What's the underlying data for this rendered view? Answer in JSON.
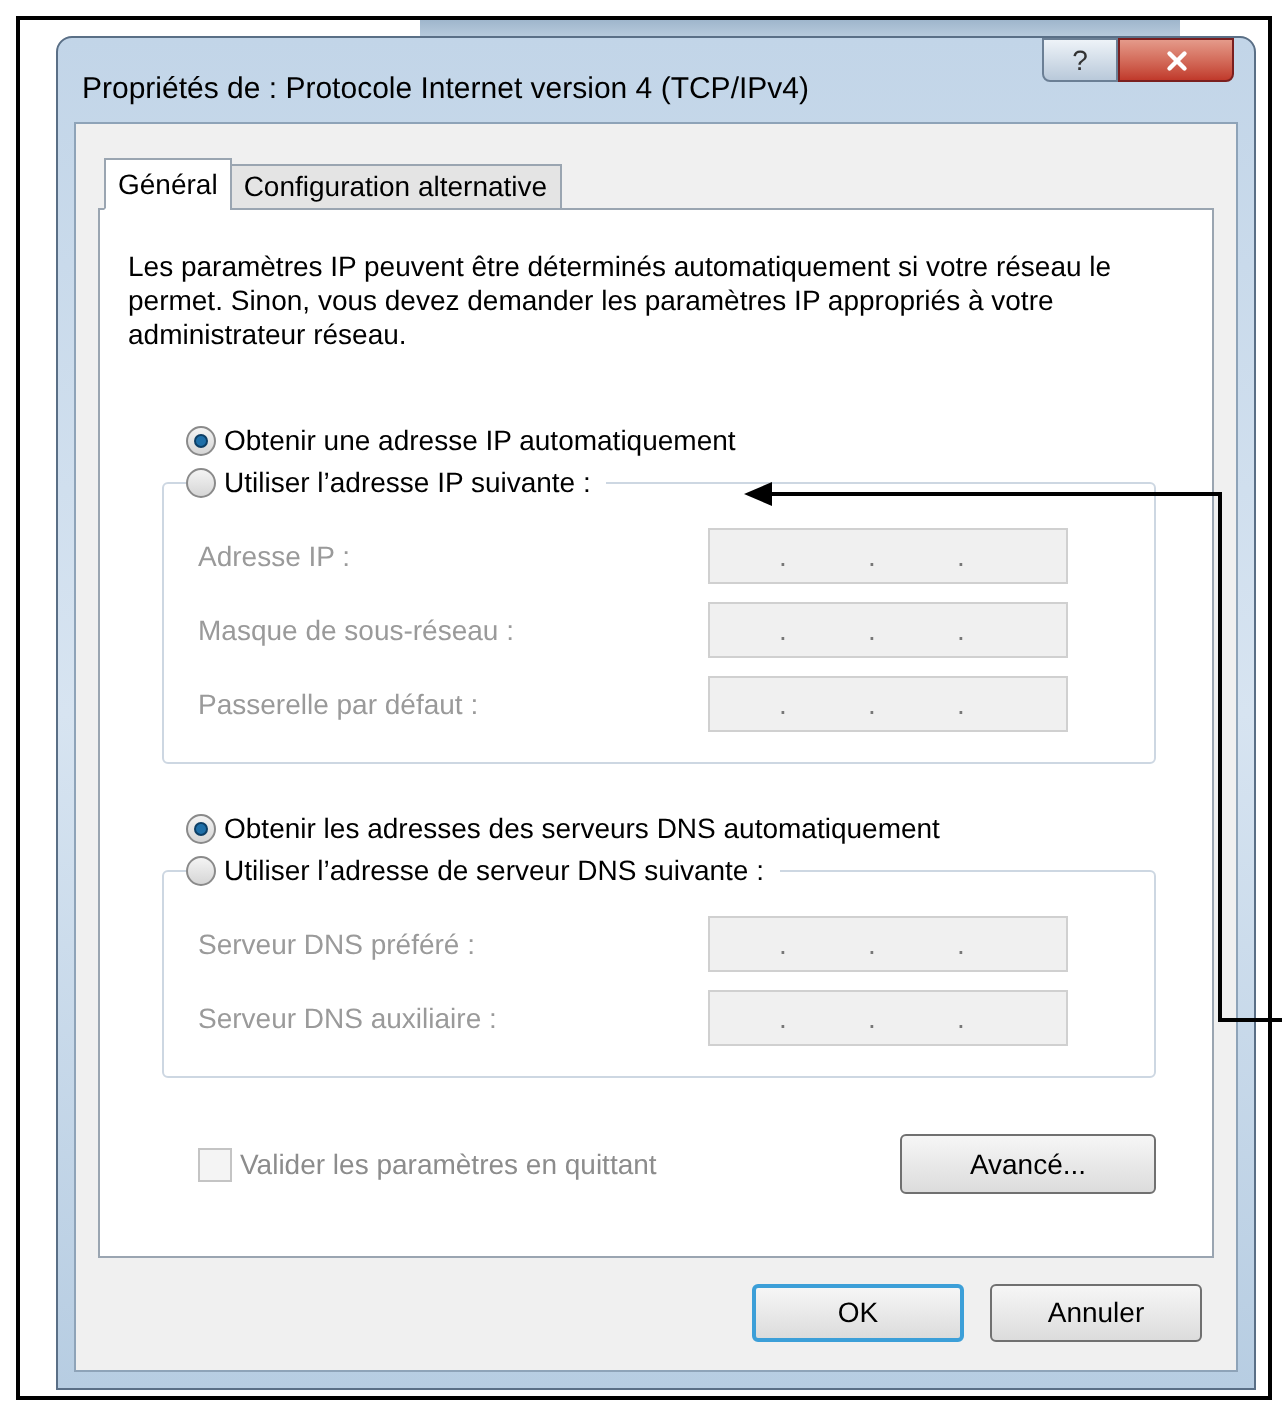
{
  "window": {
    "title": "Propriétés de : Protocole Internet version 4 (TCP/IPv4)",
    "help_button": "?"
  },
  "tabs": [
    {
      "label": "Général",
      "selected": true
    },
    {
      "label": "Configuration alternative",
      "selected": false
    }
  ],
  "description": "Les paramètres IP peuvent être déterminés automatiquement si votre réseau le permet. Sinon, vous devez demander les paramètres IP appropriés à votre administrateur réseau.",
  "sections": [
    {
      "options": [
        {
          "label": "Obtenir une adresse IP automatiquement",
          "selected": true
        },
        {
          "label": "Utiliser l’adresse IP suivante :",
          "selected": false
        }
      ],
      "fields": [
        {
          "label": "Adresse IP :",
          "separators": [
            ".",
            ".",
            "."
          ],
          "disabled": true
        },
        {
          "label": "Masque de sous-réseau :",
          "separators": [
            ".",
            ".",
            "."
          ],
          "disabled": true
        },
        {
          "label": "Passerelle par défaut :",
          "separators": [
            ".",
            ".",
            "."
          ],
          "disabled": true
        }
      ]
    },
    {
      "options": [
        {
          "label": "Obtenir les adresses des serveurs DNS automatiquement",
          "selected": true
        },
        {
          "label": "Utiliser l’adresse de serveur DNS suivante :",
          "selected": false
        }
      ],
      "fields": [
        {
          "label": "Serveur DNS préféré :",
          "separators": [
            ".",
            ".",
            "."
          ],
          "disabled": true
        },
        {
          "label": "Serveur DNS auxiliaire :",
          "separators": [
            ".",
            ".",
            "."
          ],
          "disabled": true
        }
      ]
    }
  ],
  "validate": {
    "label": "Valider les paramètres en quittant",
    "checked": false,
    "disabled": true
  },
  "advanced_button": "Avancé...",
  "buttons": [
    {
      "label": "OK",
      "default": true
    },
    {
      "label": "Annuler",
      "default": false
    }
  ]
}
